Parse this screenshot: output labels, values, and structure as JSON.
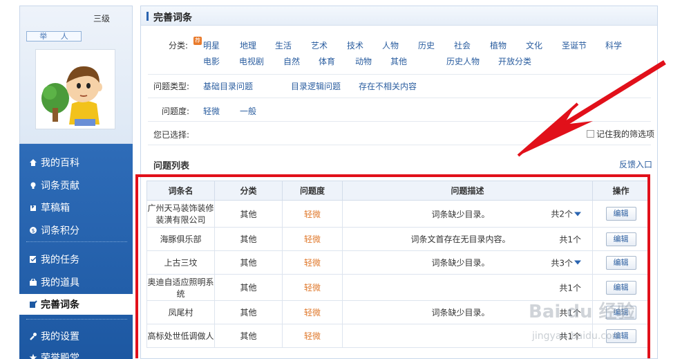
{
  "user": {
    "level": "三级",
    "report_label": "举 人"
  },
  "nav": {
    "items": [
      {
        "label": "我的百科",
        "icon": "home-icon"
      },
      {
        "label": "词条贡献",
        "icon": "bulb-icon"
      },
      {
        "label": "草稿箱",
        "icon": "draft-icon"
      },
      {
        "label": "词条积分",
        "icon": "coin-icon"
      },
      {
        "label": "我的任务",
        "icon": "task-icon"
      },
      {
        "label": "我的道具",
        "icon": "tools-icon"
      },
      {
        "label": "完善词条",
        "icon": "edit-entry-icon",
        "active": true
      },
      {
        "label": "我的设置",
        "icon": "wrench-icon"
      },
      {
        "label": "荣誉殿堂",
        "icon": "star-icon"
      }
    ]
  },
  "main": {
    "title": "完善词条",
    "category_label": "分类:",
    "recommend_badge": "荐",
    "categories_row1": [
      "明星",
      "地理",
      "生活",
      "艺术",
      "技术",
      "人物",
      "历史",
      "社会",
      "植物",
      "文化",
      "圣诞节",
      "科学"
    ],
    "categories_row2": [
      "电影",
      "电视剧",
      "自然",
      "体育",
      "动物",
      "其他",
      "历史人物",
      "开放分类"
    ],
    "problem_type_label": "问题类型:",
    "problem_types": [
      "基础目录问题",
      "目录逻辑问题",
      "存在不相关内容"
    ],
    "severity_label": "问题度:",
    "severities": [
      "轻微",
      "一般"
    ],
    "selected_label": "您已选择:",
    "remember_label": "记住我的筛选项",
    "list_title": "问题列表",
    "feedback_label": "反馈入口"
  },
  "table": {
    "headers": [
      "词条名",
      "分类",
      "问题度",
      "问题描述",
      "操作"
    ],
    "rows": [
      {
        "name": "广州天马装饰装修装潢有限公司",
        "category": "其他",
        "severity": "轻微",
        "desc": "词条缺少目录。",
        "count": "共2个",
        "expand": true,
        "action": "编辑"
      },
      {
        "name": "海豚俱乐部",
        "category": "其他",
        "severity": "轻微",
        "desc": "词条文首存在无目录内容。",
        "count": "共1个",
        "expand": false,
        "action": "编辑"
      },
      {
        "name": "上古三坟",
        "category": "其他",
        "severity": "轻微",
        "desc": "词条缺少目录。",
        "count": "共3个",
        "expand": true,
        "action": "编辑"
      },
      {
        "name": "奥迪自适应照明系统",
        "category": "其他",
        "severity": "轻微",
        "desc": "",
        "count": "共1个",
        "expand": false,
        "action": "编辑"
      },
      {
        "name": "凤尾村",
        "category": "其他",
        "severity": "轻微",
        "desc": "词条缺少目录。",
        "count": "共1个",
        "expand": false,
        "action": "编辑"
      },
      {
        "name": "高标处世低调做人",
        "category": "其他",
        "severity": "轻微",
        "desc": "",
        "count": "共1个",
        "expand": false,
        "action": "编辑"
      }
    ]
  },
  "watermark": {
    "text": "Bai du 经验",
    "sub": "jingyan.baidu.com"
  },
  "colors": {
    "nav_bg": "#1d58a2",
    "link": "#2a5d9f",
    "severity": "#e07a2e",
    "highlight": "#e1101a"
  }
}
